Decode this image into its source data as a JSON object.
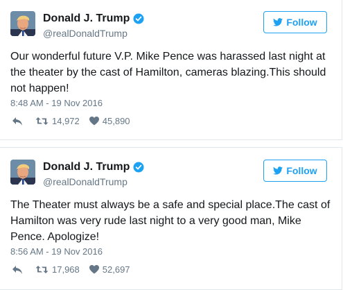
{
  "colors": {
    "accent": "#1da1f2",
    "muted": "#657786",
    "text": "#14171a",
    "border": "#e1e8ed"
  },
  "tweets": [
    {
      "display_name": "Donald J. Trump",
      "handle": "@realDonaldTrump",
      "follow_label": "Follow",
      "text": "Our wonderful future V.P. Mike Pence was harassed last night at the theater by the cast of Hamilton, cameras blazing.This should not happen!",
      "timestamp": "8:48 AM - 19 Nov 2016",
      "retweets": "14,972",
      "likes": "45,890",
      "icons": [
        "avatar",
        "verified-badge-icon",
        "twitter-bird-icon",
        "reply-icon",
        "retweet-icon",
        "heart-icon"
      ]
    },
    {
      "display_name": "Donald J. Trump",
      "handle": "@realDonaldTrump",
      "follow_label": "Follow",
      "text": "The Theater must always be a safe and special place.The cast of Hamilton was very rude last night to a very good man, Mike Pence. Apologize!",
      "timestamp": "8:56 AM - 19 Nov 2016",
      "retweets": "17,968",
      "likes": "52,697",
      "icons": [
        "avatar",
        "verified-badge-icon",
        "twitter-bird-icon",
        "reply-icon",
        "retweet-icon",
        "heart-icon"
      ]
    }
  ]
}
